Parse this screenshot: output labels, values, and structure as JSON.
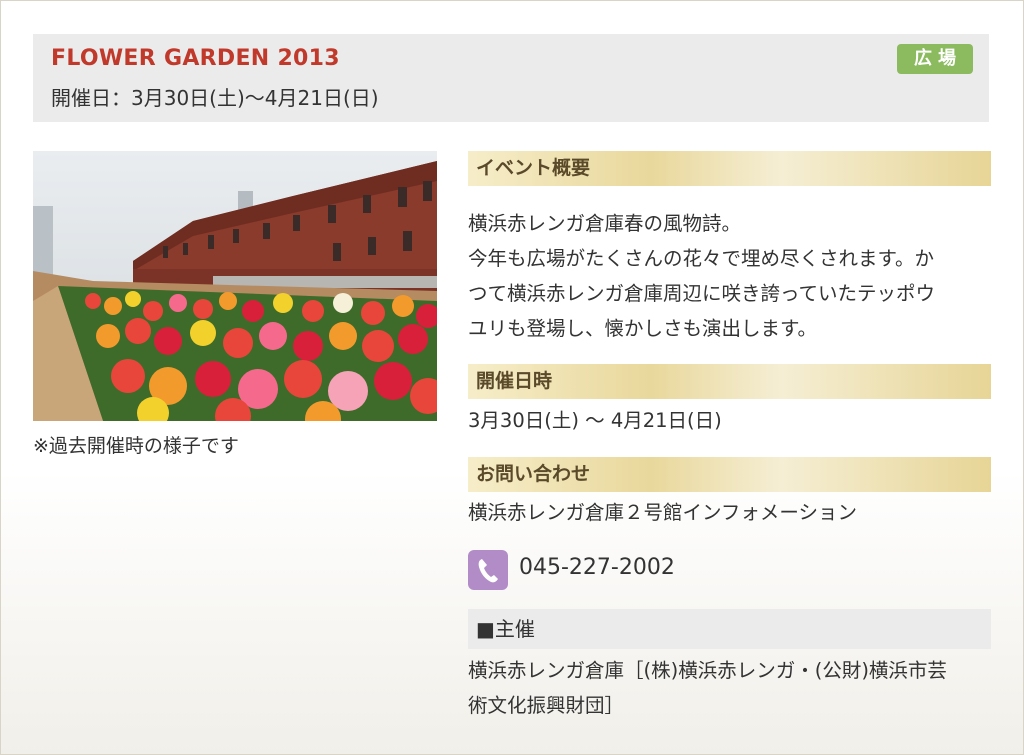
{
  "header": {
    "title": "FLOWER GARDEN 2013",
    "dates": "開催日：3月30日(土)〜4月21日(日)",
    "badge": "広場"
  },
  "photo": {
    "caption": "※過去開催時の様子です"
  },
  "overview": {
    "heading": "イベント概要",
    "lines": [
      "横浜赤レンガ倉庫春の風物詩。",
      "今年も広場がたくさんの花々で埋め尽くされます。か",
      "つて横浜赤レンガ倉庫周辺に咲き誇っていたテッポウ",
      "ユリも登場し、懐かしさも演出します。"
    ]
  },
  "schedule": {
    "heading": "開催日時",
    "value": "3月30日(土) 〜 4月21日(日)"
  },
  "contact": {
    "heading": "お問い合わせ",
    "name": "横浜赤レンガ倉庫２号館インフォメーション",
    "phone": "045-227-2002",
    "icon": "phone-icon"
  },
  "organizer": {
    "heading": "■主催",
    "lines": [
      "横浜赤レンガ倉庫［(株)横浜赤レンガ・(公財)横浜市芸",
      "術文化振興財団］"
    ]
  },
  "colors": {
    "title_red": "#c0392b",
    "badge_green": "#8bbb5e",
    "phone_purple": "#b28cc7"
  }
}
